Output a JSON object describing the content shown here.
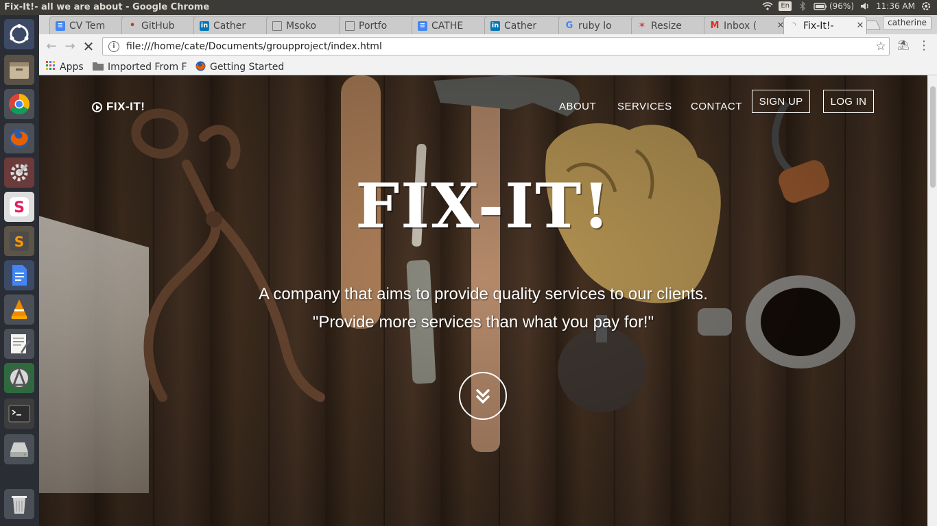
{
  "os": {
    "window_title": "Fix-It!- all we are about - Google Chrome",
    "keyboard_layout": "En",
    "battery": "(96%)",
    "clock": "11:36 AM",
    "launcher_apps": [
      "ubuntu-dash-icon",
      "files-icon",
      "chrome-icon",
      "firefox-icon",
      "system-settings-icon",
      "slack-icon",
      "sublime-text-icon",
      "google-docs-icon",
      "vlc-icon",
      "text-editor-icon",
      "software-updater-icon",
      "terminal-icon",
      "disk-icon",
      "trash-icon"
    ]
  },
  "browser": {
    "tabs": [
      {
        "label": "CV Tem",
        "favicon": "docs",
        "color": "#4285f4"
      },
      {
        "label": "GitHub",
        "favicon": "github",
        "color": "#c0392b"
      },
      {
        "label": "Cather",
        "favicon": "linkedin",
        "color": "#0077b5"
      },
      {
        "label": "Msoko",
        "favicon": "page",
        "color": "#777777"
      },
      {
        "label": "Portfo",
        "favicon": "page",
        "color": "#777777"
      },
      {
        "label": "CATHE",
        "favicon": "docs",
        "color": "#4285f4"
      },
      {
        "label": "Cather",
        "favicon": "linkedin",
        "color": "#0077b5"
      },
      {
        "label": "ruby lo",
        "favicon": "google",
        "color": "#4285f4"
      },
      {
        "label": "Resize",
        "favicon": "resize",
        "color": "#d64541"
      },
      {
        "label": "Inbox (",
        "favicon": "gmail",
        "color": "#d93025"
      },
      {
        "label": "Fix-It!-",
        "favicon": "loading",
        "color": "#e8710a"
      }
    ],
    "profile_name": "catherine",
    "url": "file:///home/cate/Documents/groupproject/index.html",
    "bookmarks": [
      {
        "label": "Apps",
        "icon": "apps-grid-icon"
      },
      {
        "label": "Imported From F",
        "icon": "folder-icon"
      },
      {
        "label": "Getting Started",
        "icon": "firefox-icon"
      }
    ]
  },
  "site": {
    "brand": "FIX-IT!",
    "nav": [
      "ABOUT",
      "SERVICES",
      "CONTACT"
    ],
    "signup_label": "SIGN UP",
    "login_label": "LOG IN",
    "hero_title": "FIX-IT!",
    "tagline": "A company that aims to provide quality services to our clients.",
    "motto": "\"Provide more services than what you pay for!\""
  }
}
